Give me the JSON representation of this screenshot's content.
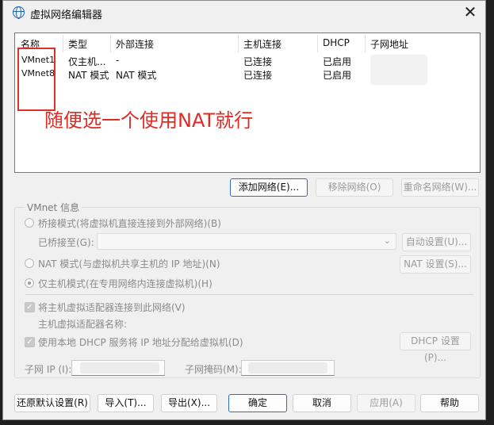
{
  "window": {
    "title": "虚拟网络编辑器",
    "close": "✕"
  },
  "list": {
    "headers": [
      "名称",
      "类型",
      "外部连接",
      "主机连接",
      "DHCP",
      "子网地址"
    ],
    "rows": [
      {
        "name": "VMnet1",
        "type": "仅主机...",
        "external": "-",
        "host": "已连接",
        "dhcp": "已启用"
      },
      {
        "name": "VMnet8",
        "type": "NAT 模式",
        "external": "NAT 模式",
        "host": "已连接",
        "dhcp": "已启用"
      }
    ],
    "annotation": "随便选一个使用NAT就行",
    "annotation_color": "#e02a24"
  },
  "list_buttons": {
    "add": "添加网络(E)...",
    "remove": "移除网络(O)",
    "rename": "重命名网络(W)..."
  },
  "vmnet_info": {
    "title": "VMnet 信息",
    "bridge_label": "桥接模式(将虚拟机直接连接到外部网络)(B)",
    "bridged_to_label": "已桥接至(G):",
    "bridged_to_value": "",
    "auto_settings": "自动设置(U)...",
    "nat_label": "NAT 模式(与虚拟机共享主机的 IP 地址)(N)",
    "nat_settings": "NAT 设置(S)...",
    "hostonly_label": "仅主机模式(在专用网络内连接虚拟机)(H)",
    "selected_mode": "hostonly",
    "connect_adapter_label": "将主机虚拟适配器连接到此网络(V)",
    "adapter_name_label": "主机虚拟适配器名称:",
    "dhcp_label": "使用本地 DHCP 服务将 IP 地址分配给虚拟机(D)",
    "dhcp_settings": "DHCP 设置(P)...",
    "subnet_ip_label": "子网 IP (I):",
    "subnet_mask_label": "子网掩码(M):"
  },
  "footer": {
    "restore": "还原默认设置(R)",
    "import": "导入(T)...",
    "export": "导出(X)...",
    "ok": "确定",
    "cancel": "取消",
    "apply": "应用(A)",
    "help": "帮助"
  }
}
